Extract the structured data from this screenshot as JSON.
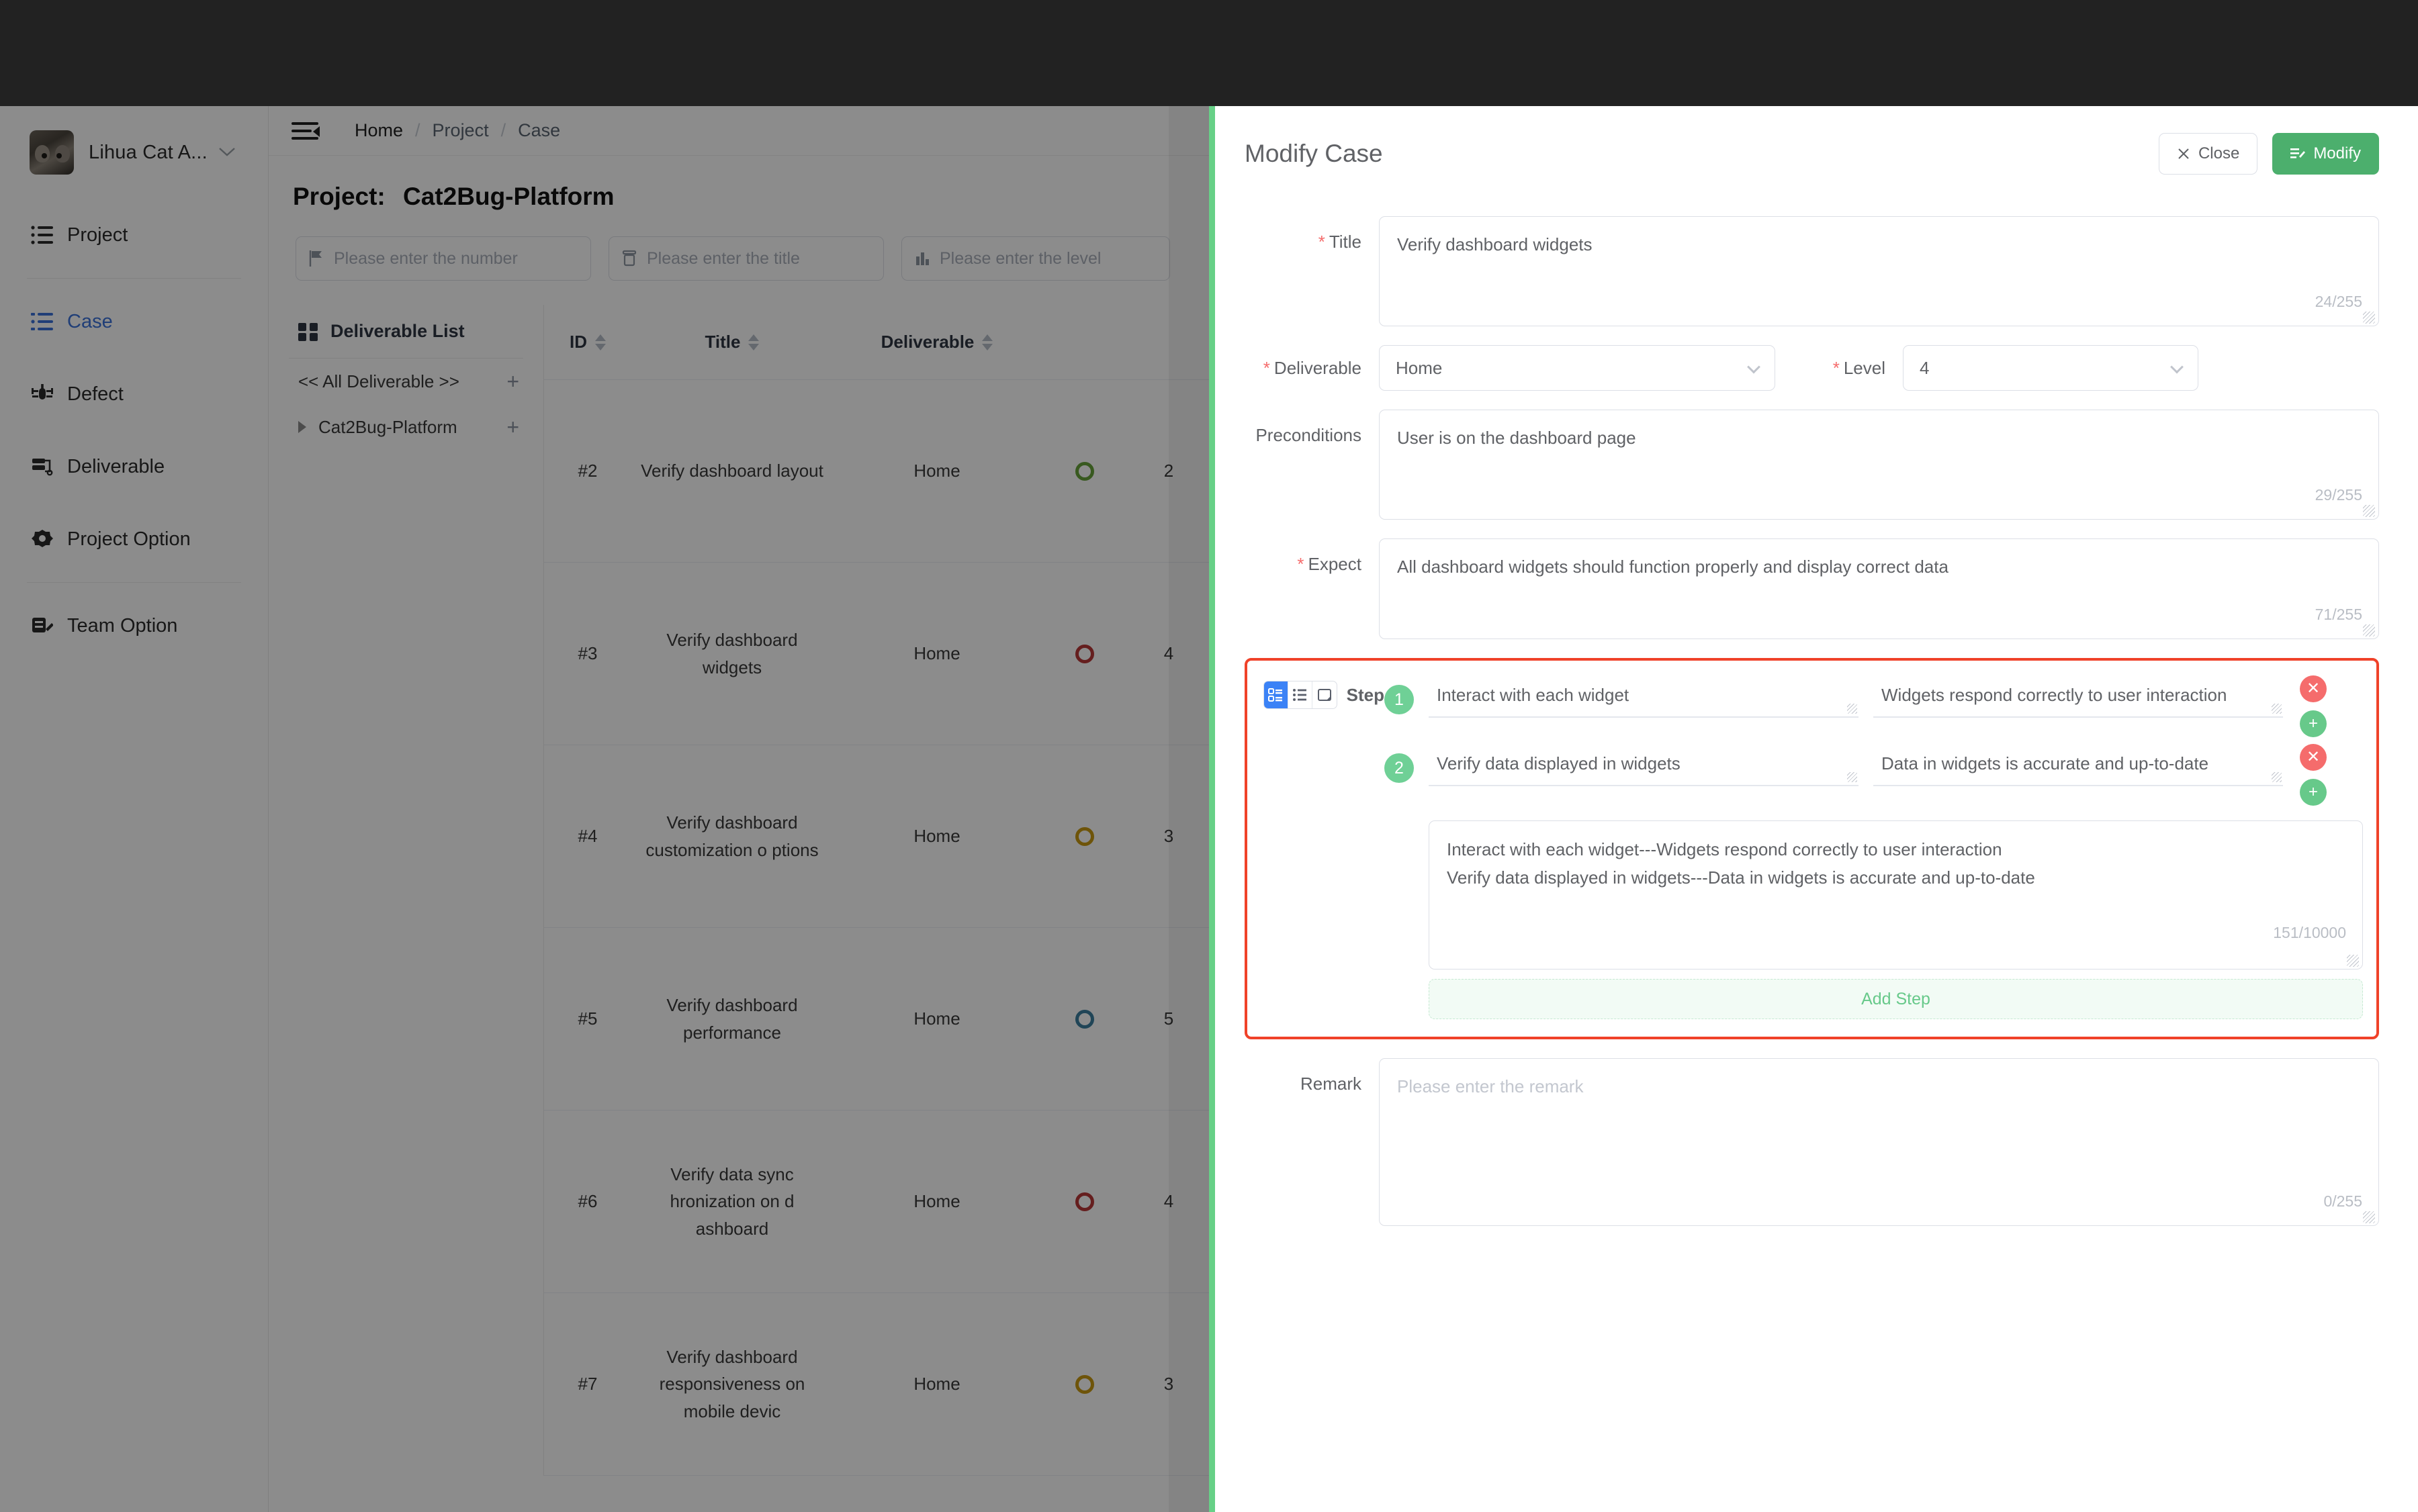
{
  "sidebar": {
    "user": {
      "name": "Lihua Cat A...",
      "avatar_icon": "cat-avatar",
      "caret_icon": "chevron-down-icon"
    },
    "items": [
      {
        "label": "Project",
        "icon": "list-icon",
        "active": false
      },
      {
        "label": "Case",
        "icon": "case-list-icon",
        "active": true
      },
      {
        "label": "Defect",
        "icon": "bug-icon",
        "active": false
      },
      {
        "label": "Deliverable",
        "icon": "deliverable-icon",
        "active": false
      },
      {
        "label": "Project Option",
        "icon": "gear-icon",
        "active": false
      },
      {
        "label": "Team Option",
        "icon": "team-option-icon",
        "active": false
      }
    ]
  },
  "breadcrumb": {
    "items": [
      "Home",
      "Project",
      "Case"
    ],
    "separator": "/",
    "menu_icon": "hamburger-collapse-icon"
  },
  "page": {
    "title_prefix": "Project:",
    "project_name": "Cat2Bug-Platform"
  },
  "filters": [
    {
      "name": "number",
      "placeholder": "Please enter the number",
      "value": "",
      "icon": "flag-icon"
    },
    {
      "name": "title",
      "placeholder": "Please enter the title",
      "value": "",
      "icon": "box-icon"
    },
    {
      "name": "level",
      "placeholder": "Please enter the level",
      "value": "",
      "icon": "bar-chart-icon"
    }
  ],
  "deliverable_panel": {
    "title": "Deliverable List",
    "icon": "grid-icon",
    "rows": [
      {
        "label": "<< All Deliverable >>",
        "has_caret": false,
        "add_icon": "plus-icon"
      },
      {
        "label": "Cat2Bug-Platform",
        "has_caret": true,
        "add_icon": "plus-icon"
      }
    ]
  },
  "table": {
    "columns": [
      "ID",
      "Title",
      "Deliverable",
      "",
      ""
    ],
    "rows": [
      {
        "id": "#2",
        "title": "Verify dashboard layout",
        "deliverable": "Home",
        "status_color": "#67a23a",
        "level": "2"
      },
      {
        "id": "#3",
        "title": "Verify dashboard widgets",
        "deliverable": "Home",
        "status_color": "#b93737",
        "level": "4"
      },
      {
        "id": "#4",
        "title": "Verify dashboard customization o ptions",
        "deliverable": "Home",
        "status_color": "#c99a12",
        "level": "3"
      },
      {
        "id": "#5",
        "title": "Verify dashboard performance",
        "deliverable": "Home",
        "status_color": "#3b7f9e",
        "level": "5"
      },
      {
        "id": "#6",
        "title": "Verify data sync hronization on d ashboard",
        "deliverable": "Home",
        "status_color": "#b93737",
        "level": "4"
      },
      {
        "id": "#7",
        "title": "Verify dashboard responsiveness on mobile devic",
        "deliverable": "Home",
        "status_color": "#c99a12",
        "level": "3"
      }
    ]
  },
  "modal": {
    "title": "Modify Case",
    "close_label": "Close",
    "close_icon": "close-icon",
    "modify_label": "Modify",
    "modify_icon": "edit-list-icon",
    "accent_green": "#4caf6d",
    "highlight_red": "#f04229",
    "fields": {
      "title": {
        "label": "Title",
        "required": true,
        "value": "Verify dashboard widgets",
        "counter": "24/255"
      },
      "deliverable": {
        "label": "Deliverable",
        "required": true,
        "value": "Home",
        "chevron_icon": "chevron-down-icon"
      },
      "level": {
        "label": "Level",
        "required": true,
        "value": "4",
        "chevron_icon": "chevron-down-icon"
      },
      "preconditions": {
        "label": "Preconditions",
        "required": false,
        "value": "User is on the dashboard page",
        "counter": "29/255"
      },
      "expect": {
        "label": "Expect",
        "required": true,
        "value": "All dashboard widgets should function properly and display correct data",
        "counter": "71/255"
      },
      "remark": {
        "label": "Remark",
        "required": false,
        "value": "",
        "placeholder": "Please enter the remark",
        "counter": "0/255"
      }
    },
    "step_section": {
      "label": "Step",
      "view_modes": [
        {
          "name": "card-view",
          "selected": true
        },
        {
          "name": "list-view",
          "selected": false
        },
        {
          "name": "text-view",
          "selected": false
        }
      ],
      "steps": [
        {
          "number": "1",
          "action": "Interact with each widget",
          "expect": "Widgets respond correctly to user interaction",
          "delete_icon": "close-circle-icon",
          "add_icon": "plus-circle-icon"
        },
        {
          "number": "2",
          "action": "Verify data displayed in widgets",
          "expect": "Data in widgets is accurate and up-to-date",
          "delete_icon": "close-circle-icon",
          "add_icon": "plus-circle-icon"
        }
      ],
      "raw_text": "Interact with each widget---Widgets respond correctly to user interaction\nVerify data displayed in widgets---Data in widgets is accurate and up-to-date",
      "raw_counter": "151/10000",
      "add_step_label": "Add Step"
    }
  }
}
